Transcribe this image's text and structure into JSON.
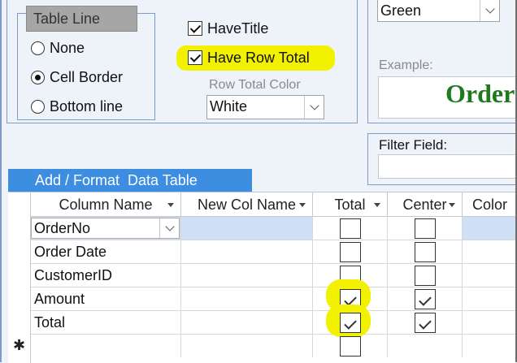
{
  "table_line": {
    "title": "Table Line",
    "options": [
      {
        "label": "None",
        "selected": false
      },
      {
        "label": "Cell Border",
        "selected": true
      },
      {
        "label": "Bottom line",
        "selected": false
      }
    ]
  },
  "have_title": {
    "label": "HaveTitle",
    "checked": true
  },
  "have_row_total": {
    "label": "Have Row Total",
    "checked": true
  },
  "row_total_color": {
    "label": "Row Total Color",
    "value": "White"
  },
  "title_color": {
    "value": "Green"
  },
  "example": {
    "label": "Example:",
    "text": "Order L"
  },
  "filter": {
    "label": "Filter Field:",
    "value": ""
  },
  "data_table": {
    "tab_label": "Add / Format  Data Table",
    "columns": [
      "Column Name",
      "New Col Name",
      "Total",
      "Center",
      "Color"
    ],
    "rows": [
      {
        "column_name": "OrderNo",
        "new_col_name": "",
        "total": false,
        "center": false
      },
      {
        "column_name": "Order Date",
        "new_col_name": "",
        "total": false,
        "center": false
      },
      {
        "column_name": "CustomerID",
        "new_col_name": "",
        "total": false,
        "center": false
      },
      {
        "column_name": "Amount",
        "new_col_name": "",
        "total": true,
        "center": true
      },
      {
        "column_name": "Total",
        "new_col_name": "",
        "total": true,
        "center": true
      }
    ],
    "new_row_marker": "✱"
  },
  "colors": {
    "accent": "#3d8ee0",
    "highlight": "#f2f200",
    "example_text": "#1f7a1f",
    "selected_row": "#cfdff5"
  }
}
